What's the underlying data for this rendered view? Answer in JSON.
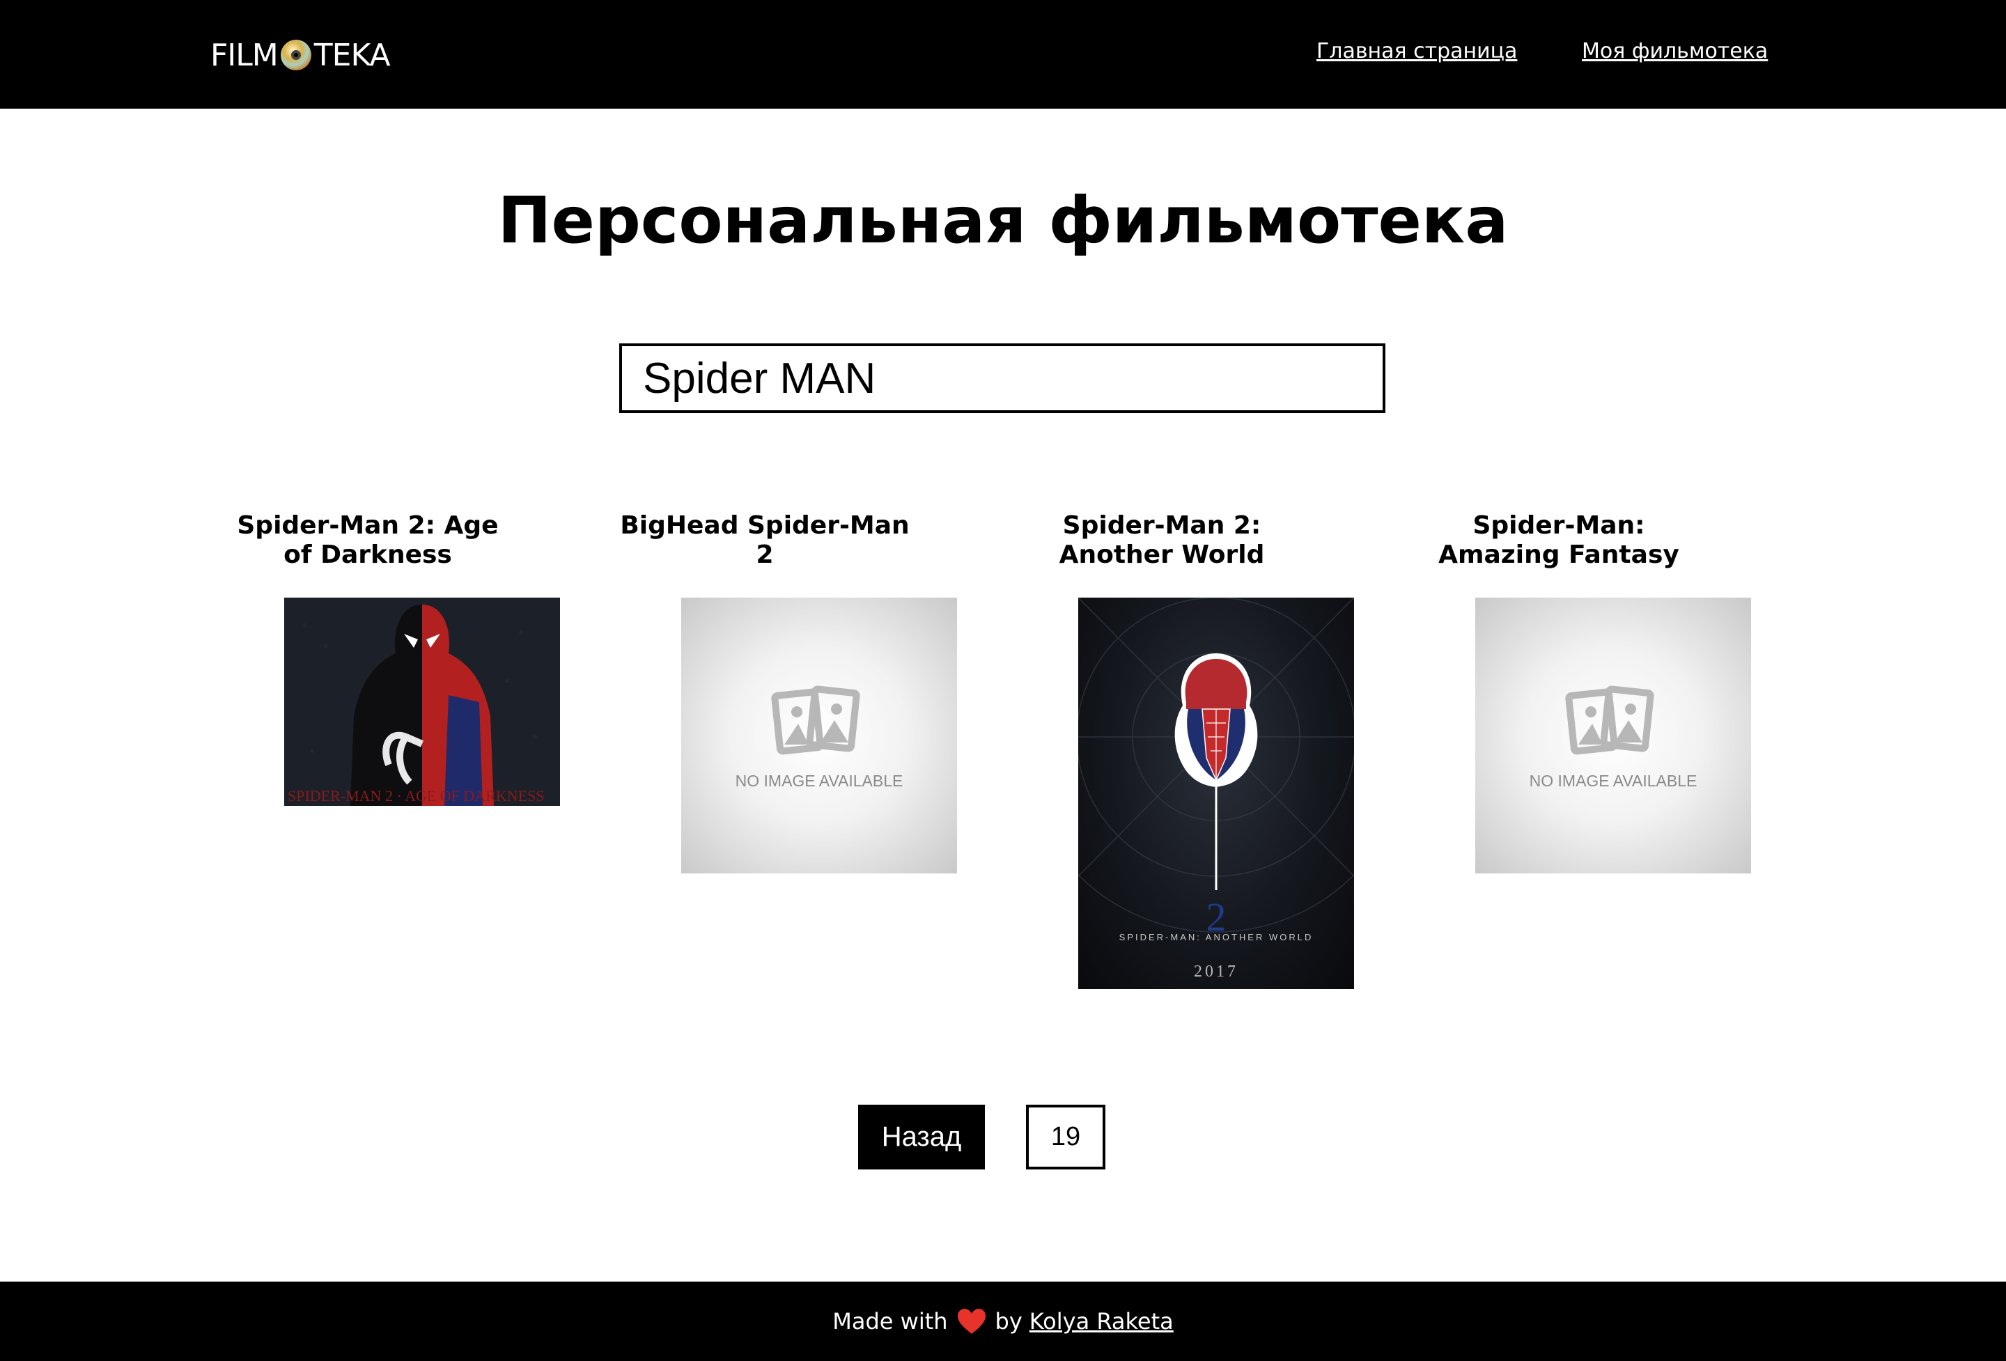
{
  "header": {
    "logo_left": "FILM",
    "logo_right": "TEKA",
    "nav": {
      "home": "Главная страница",
      "my_library": "Моя фильмотека"
    }
  },
  "page_title": "Персональная фильмотека",
  "search": {
    "value": "Spider MAN"
  },
  "movies": [
    {
      "title": "Spider-Man 2: Age of Darkness",
      "poster": "poster-image"
    },
    {
      "title": "BigHead Spider-Man 2",
      "poster": "no-image-placeholder",
      "placeholder_text": "NO IMAGE AVAILABLE"
    },
    {
      "title": "Spider-Man 2: Another World",
      "poster": "poster-image",
      "poster_text": "SPIDER-MAN: ANOTHER WORLD",
      "poster_number": "2",
      "poster_year": "2017"
    },
    {
      "title": "Spider-Man: Amazing Fantasy",
      "poster": "no-image-placeholder",
      "placeholder_text": "NO IMAGE AVAILABLE"
    }
  ],
  "pagination": {
    "back_label": "Назад",
    "page": "19"
  },
  "footer": {
    "made_with": "Made with",
    "by": "by",
    "author": "Kolya Raketa",
    "heart_icon": "heart-icon"
  },
  "colors": {
    "header_bg": "#000000",
    "page_bg": "#ffffff",
    "heart": "#e8332b"
  }
}
